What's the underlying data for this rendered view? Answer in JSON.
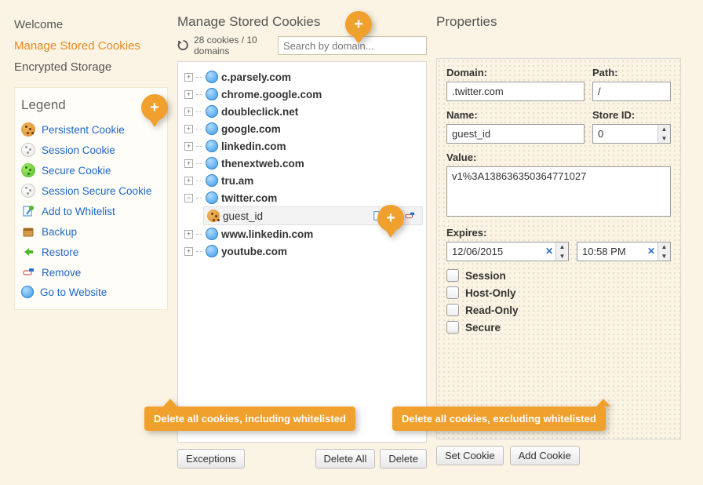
{
  "nav": {
    "welcome": "Welcome",
    "manage": "Manage Stored Cookies",
    "encrypted": "Encrypted Storage"
  },
  "legend": {
    "title": "Legend",
    "items": [
      {
        "label": "Persistent Cookie",
        "icon": "cookie-persistent"
      },
      {
        "label": "Session Cookie",
        "icon": "cookie-session"
      },
      {
        "label": "Secure Cookie",
        "icon": "cookie-secure"
      },
      {
        "label": "Session Secure Cookie",
        "icon": "cookie-session-secure"
      },
      {
        "label": "Add to Whitelist",
        "icon": "whitelist"
      },
      {
        "label": "Backup",
        "icon": "backup"
      },
      {
        "label": "Restore",
        "icon": "restore"
      },
      {
        "label": "Remove",
        "icon": "remove"
      },
      {
        "label": "Go to Website",
        "icon": "goto"
      }
    ]
  },
  "mid": {
    "title": "Manage Stored Cookies",
    "count": "28 cookies / 10 domains",
    "search_placeholder": "Search by domain...",
    "domains": [
      {
        "name": "c.parsely.com",
        "expanded": false
      },
      {
        "name": "chrome.google.com",
        "expanded": false
      },
      {
        "name": "doubleclick.net",
        "expanded": false
      },
      {
        "name": "google.com",
        "expanded": false
      },
      {
        "name": "linkedin.com",
        "expanded": false
      },
      {
        "name": "thenextweb.com",
        "expanded": false
      },
      {
        "name": "tru.am",
        "expanded": false
      },
      {
        "name": "twitter.com",
        "expanded": true,
        "children": [
          {
            "name": "guest_id"
          }
        ]
      },
      {
        "name": "www.linkedin.com",
        "expanded": false
      },
      {
        "name": "youtube.com",
        "expanded": false
      }
    ],
    "btn_exceptions": "Exceptions",
    "btn_delete_all": "Delete All",
    "btn_delete": "Delete"
  },
  "right": {
    "title": "Properties",
    "labels": {
      "domain": "Domain:",
      "path": "Path:",
      "name": "Name:",
      "store": "Store ID:",
      "value": "Value:",
      "expires": "Expires:",
      "session": "Session",
      "hostonly": "Host-Only",
      "readonly": "Read-Only",
      "secure": "Secure"
    },
    "values": {
      "domain": ".twitter.com",
      "path": "/",
      "name": "guest_id",
      "store": "0",
      "value": "v1%3A138636350364771027",
      "date": "12/06/2015",
      "time": "10:58 PM"
    },
    "btn_set": "Set Cookie",
    "btn_add": "Add Cookie"
  },
  "balloons": {
    "del_all": "Delete all cookies, including whitelisted",
    "del": "Delete all cookies, excluding whitelisted"
  }
}
